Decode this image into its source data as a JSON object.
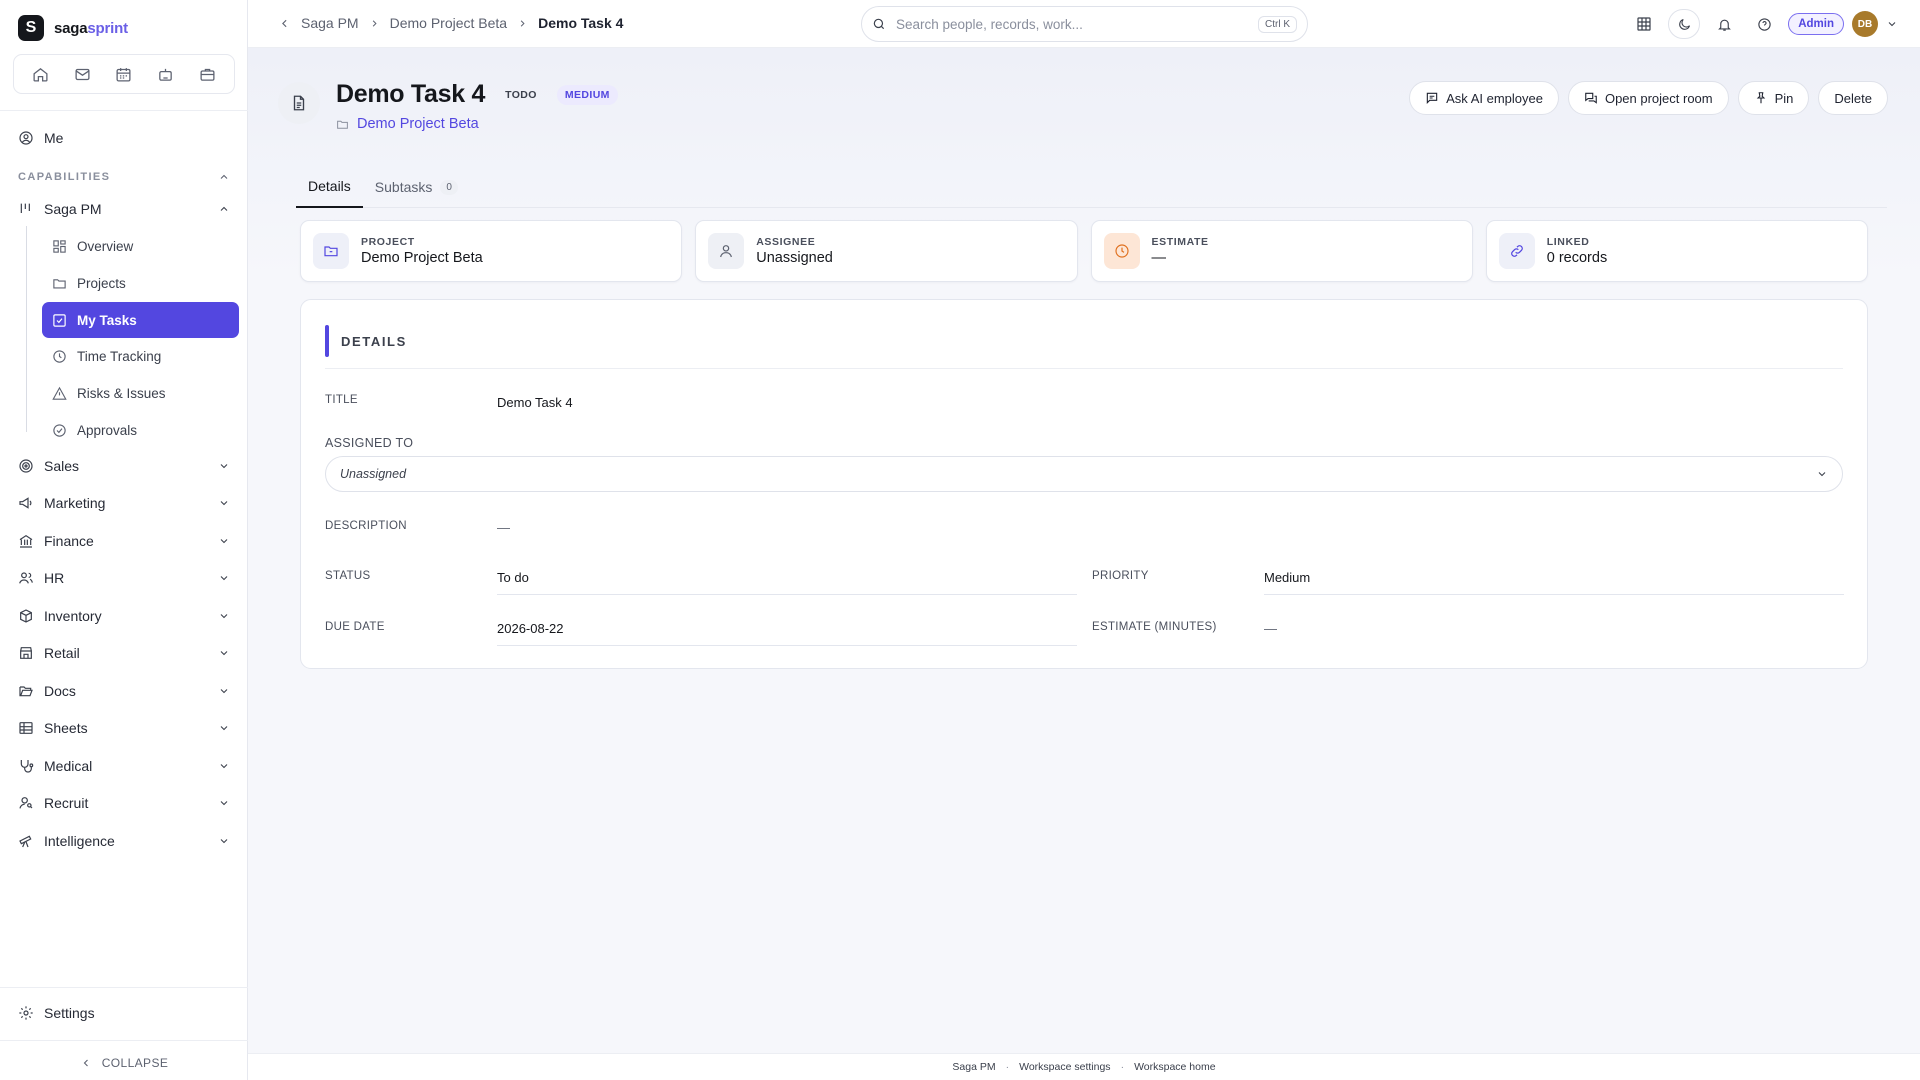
{
  "app": {
    "logo_letter": "S",
    "name_part1": "saga",
    "name_part2": "sprint",
    "accent": "#5347e0"
  },
  "sidebar": {
    "quick_icons": [
      "home-icon",
      "mail-icon",
      "calendar-icon",
      "bot-icon",
      "briefcase-icon"
    ],
    "me": "Me",
    "capabilities_label": "CAPABILITIES",
    "active_group": "Saga PM",
    "sub_items": [
      {
        "label": "Overview",
        "icon": "dashboard-icon"
      },
      {
        "label": "Projects",
        "icon": "folder-icon"
      },
      {
        "label": "My Tasks",
        "icon": "checkbox-icon",
        "active": true
      },
      {
        "label": "Time Tracking",
        "icon": "clock-icon"
      },
      {
        "label": "Risks & Issues",
        "icon": "warning-icon"
      },
      {
        "label": "Approvals",
        "icon": "check-circle-icon"
      }
    ],
    "groups": [
      {
        "label": "Sales",
        "icon": "target-icon"
      },
      {
        "label": "Marketing",
        "icon": "megaphone-icon"
      },
      {
        "label": "Finance",
        "icon": "bank-icon"
      },
      {
        "label": "HR",
        "icon": "users-icon"
      },
      {
        "label": "Inventory",
        "icon": "box-icon"
      },
      {
        "label": "Retail",
        "icon": "store-icon"
      },
      {
        "label": "Docs",
        "icon": "folder-open-icon"
      },
      {
        "label": "Sheets",
        "icon": "table-icon"
      },
      {
        "label": "Medical",
        "icon": "stethoscope-icon"
      },
      {
        "label": "Recruit",
        "icon": "user-search-icon"
      },
      {
        "label": "Intelligence",
        "icon": "telescope-icon"
      }
    ],
    "settings": "Settings",
    "collapse": "COLLAPSE"
  },
  "topbar": {
    "breadcrumb": [
      "Saga PM",
      "Demo Project Beta",
      "Demo Task 4"
    ],
    "search_placeholder": "Search people, records, work...",
    "search_shortcut": "Ctrl K",
    "role": "Admin",
    "avatar_initials": "DB"
  },
  "task": {
    "title": "Demo Task 4",
    "status_badge": "TODO",
    "priority_badge": "MEDIUM",
    "project": "Demo Project Beta",
    "actions": {
      "ask_ai": "Ask AI employee",
      "open_room": "Open project room",
      "pin": "Pin",
      "delete": "Delete"
    }
  },
  "tabs": {
    "details": "Details",
    "subtasks": "Subtasks",
    "subtasks_count": "0"
  },
  "cards": [
    {
      "label": "PROJECT",
      "value": "Demo Project Beta",
      "icon": "folder-icon",
      "color": "#5347e0",
      "bg": "#eef0f8"
    },
    {
      "label": "ASSIGNEE",
      "value": "Unassigned",
      "icon": "user-icon",
      "color": "#5d6270",
      "bg": "#eef0f5"
    },
    {
      "label": "ESTIMATE",
      "value": "—",
      "icon": "clock-icon",
      "color": "#e0701f",
      "bg": "#fde6d6"
    },
    {
      "label": "LINKED",
      "value": "0 records",
      "icon": "link-icon",
      "color": "#5347e0",
      "bg": "#eef0f8"
    }
  ],
  "details": {
    "heading": "DETAILS",
    "title_label": "TITLE",
    "title_value": "Demo Task 4",
    "assigned_label": "ASSIGNED TO",
    "assigned_value": "Unassigned",
    "description_label": "DESCRIPTION",
    "description_value": "—",
    "status_label": "STATUS",
    "status_value": "To do",
    "priority_label": "PRIORITY",
    "priority_value": "Medium",
    "due_label": "DUE DATE",
    "due_value": "2026-08-22",
    "estimate_label": "ESTIMATE (MINUTES)",
    "estimate_value": "—"
  },
  "footer": {
    "links": [
      "Saga PM",
      "Workspace settings",
      "Workspace home"
    ]
  }
}
